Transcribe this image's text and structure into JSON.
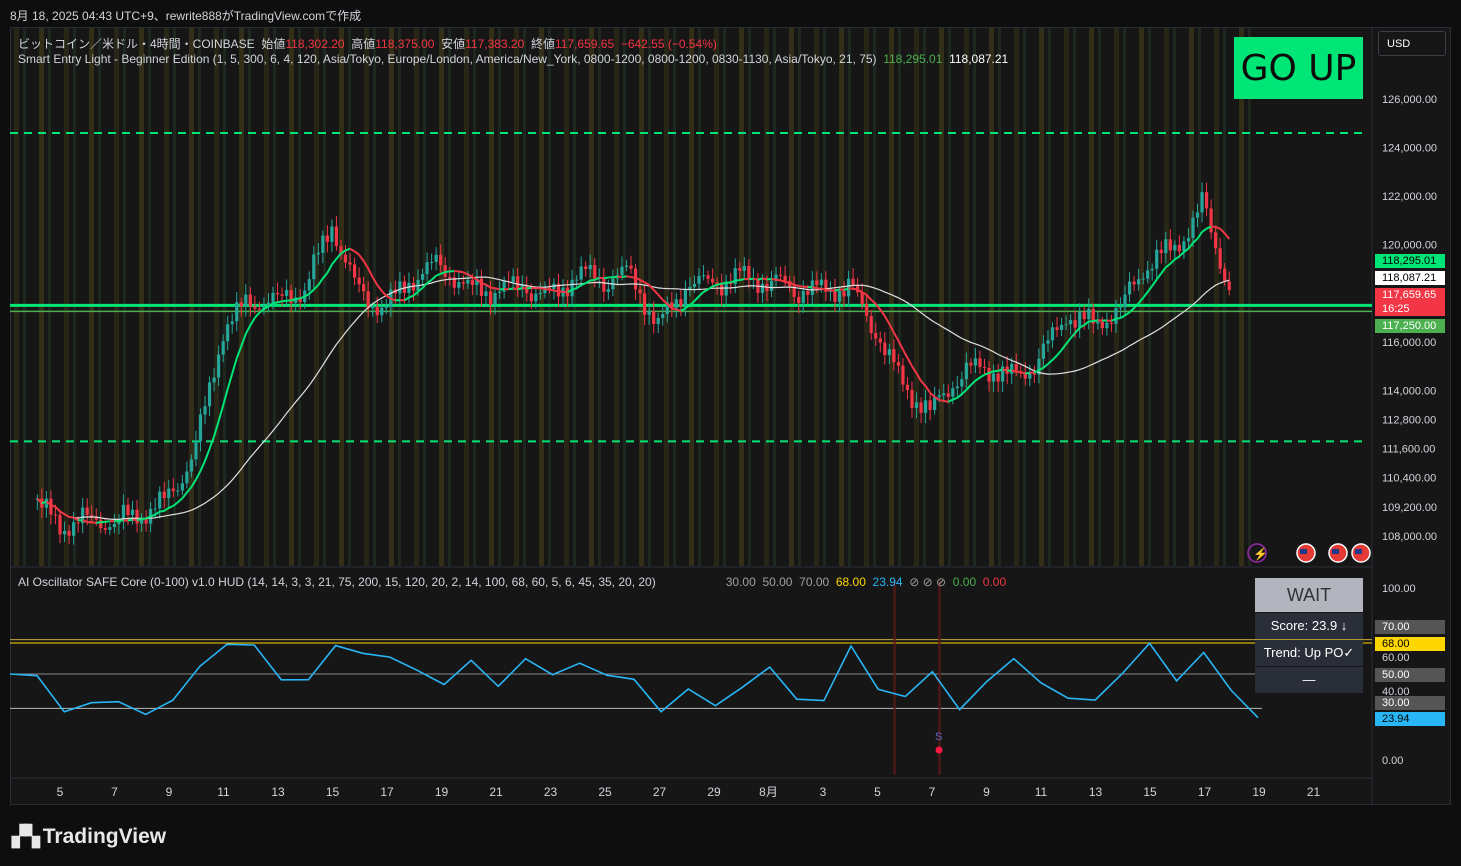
{
  "header": {
    "caption": "8月 18, 2025 04:43 UTC+9、rewrite888がTradingView.comで作成"
  },
  "symbol": {
    "name": "ビットコイン／米ドル・4時間・COINBASE",
    "open_label": "始値",
    "open": "118,302.20",
    "high_label": "高値",
    "high": "118,375.00",
    "low_label": "安値",
    "low": "117,383.20",
    "close_label": "終値",
    "close": "117,659.65",
    "change": "−642.55 (−0.54%)"
  },
  "indicator1": {
    "name": "Smart Entry Light - Beginner Edition (1, 5, 300, 6, 4, 120, Asia/Tokyo, Europe/London, America/New_York, 0800-1200, 0800-1200, 0830-1130, Asia/Tokyo, 21, 75)",
    "value1": "118,295.01",
    "value2": "118,087.21"
  },
  "indicator2": {
    "name": "AI Oscillator SAFE Core (0-100) v1.0 HUD (14, 14, 3, 3, 21, 75, 200, 15, 120, 20, 2, 14, 100, 68, 60, 5, 6, 45, 35, 20, 20)",
    "values": [
      "30.00",
      "50.00",
      "70.00"
    ],
    "v68": "68.00",
    "v2394": "23.94",
    "slashes": "⊘ ⊘ ⊘",
    "v0g": "0.00",
    "v0r": "0.00"
  },
  "signal": {
    "label": "GO UP",
    "color": "#00e676"
  },
  "currency": "USD",
  "price_axis": {
    "ticks": [
      "126,000.00",
      "124,000.00",
      "122,000.00",
      "120,000.00",
      "116,000.00",
      "114,000.00",
      "112,800.00",
      "111,600.00",
      "110,400.00",
      "109,200.00",
      "108,000.00"
    ]
  },
  "price_labels": {
    "ema": "118,295.01",
    "sma": "118,087.21",
    "last": "117,659.65",
    "countdown": "16:25",
    "level": "117,250.00"
  },
  "osc_axis": {
    "ticks": [
      "100.00",
      "60.00",
      "40.00",
      "0.00"
    ],
    "labels": {
      "l70": "70.00",
      "l68": "68.00",
      "l50": "50.00",
      "l30": "30.00",
      "cur": "23.94"
    }
  },
  "hud": {
    "status": "WAIT",
    "score": "Score: 23.9 ↓",
    "trend": "Trend: Up  PO✓",
    "dash": "—"
  },
  "sell_marker": "S",
  "x_axis": {
    "labels": [
      "5",
      "7",
      "9",
      "11",
      "13",
      "15",
      "17",
      "19",
      "21",
      "23",
      "25",
      "27",
      "29",
      "8月",
      "3",
      "5",
      "7",
      "9",
      "11",
      "13",
      "15",
      "17",
      "19",
      "21"
    ]
  },
  "brand": "TradingView",
  "colors": {
    "bull": "#26a69a",
    "bear": "#f23645",
    "ema_up": "#00e676",
    "ema_down": "#f23645",
    "sma": "#e0e0e0",
    "osc": "#29b6f6",
    "level": "#00e676"
  },
  "chart_data": {
    "type": "line",
    "title": "ビットコイン／米ドル・4時間・COINBASE",
    "ylim": [
      107000,
      127000
    ],
    "x_ticks": [
      "5",
      "7",
      "9",
      "11",
      "13",
      "15",
      "17",
      "19",
      "21",
      "23",
      "25",
      "27",
      "29",
      "8月",
      "3",
      "5",
      "7",
      "9",
      "11",
      "13",
      "15",
      "17",
      "19",
      "21"
    ],
    "series": [
      {
        "name": "Close",
        "x": [
          4,
          5,
          6,
          7,
          8,
          9,
          10,
          11,
          12,
          13,
          14,
          15,
          16,
          17,
          18,
          19,
          20,
          21,
          22,
          23,
          24,
          25,
          26,
          27,
          28,
          29,
          30,
          31,
          32,
          33,
          34,
          35,
          36,
          37,
          38,
          39,
          40,
          41,
          42,
          43,
          44,
          45,
          46,
          47,
          48
        ],
        "values": [
          109500,
          108400,
          108700,
          108600,
          108900,
          109500,
          111600,
          116500,
          117700,
          117700,
          118200,
          120800,
          117900,
          117400,
          118700,
          119200,
          118200,
          118100,
          118300,
          117800,
          118800,
          118600,
          118800,
          116600,
          118300,
          118400,
          118700,
          118500,
          118200,
          118100,
          118300,
          116400,
          114200,
          113100,
          114600,
          115000,
          114500,
          115200,
          117100,
          116700,
          117400,
          119300,
          119800,
          121600,
          118300
        ]
      }
    ],
    "horizontal_levels": [
      124600,
      117500,
      117250,
      111900
    ],
    "oscillator": {
      "ylim": [
        0,
        100
      ],
      "levels": [
        68,
        70,
        50,
        30
      ],
      "last": 23.94,
      "values": [
        50,
        46,
        32,
        31,
        33,
        30,
        31,
        56,
        69,
        63,
        50,
        46,
        64,
        66,
        57,
        52,
        47,
        54,
        45,
        60,
        46,
        60,
        48,
        45,
        32,
        38,
        32,
        45,
        50,
        38,
        35,
        63,
        45,
        35,
        50,
        33,
        42,
        60,
        47,
        32,
        38,
        50,
        65,
        50,
        60,
        40,
        28
      ]
    }
  }
}
